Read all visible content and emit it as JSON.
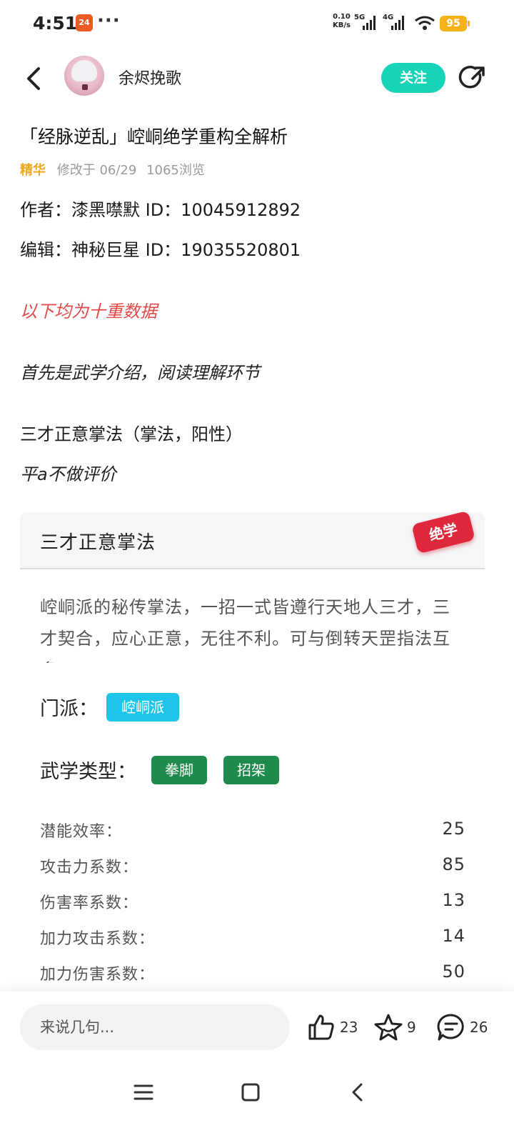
{
  "status_bar": {
    "time": "4:51",
    "app_badge": "24",
    "dots": "···",
    "net_speed_value": "0.10",
    "net_speed_unit": "KB/s",
    "sig1_label": "5G",
    "sig2_label": "4G",
    "battery": "95",
    "icons": [
      "signal-icon",
      "wifi-icon",
      "battery-icon"
    ]
  },
  "header": {
    "username": "余烬挽歌",
    "follow_label": "关注"
  },
  "article": {
    "title": "「经脉逆乱」崆峒绝学重构全解析",
    "tag": "精华",
    "modified": "修改于 06/29",
    "views": "1065浏览",
    "author_line": "作者：漆黑噤默  ID：10045912892",
    "editor_line": "编辑：神秘巨星  ID：19035520801",
    "note_red": "以下均为十重数据",
    "intro": "首先是武学介绍，阅读理解环节",
    "skill_heading": "三才正意掌法（掌法，阳性）",
    "skill_comment": "平a不做评价"
  },
  "skill_card": {
    "name": "三才正意掌法",
    "badge": "绝学",
    "description": "崆峒派的秘传掌法，一招一式皆遵行天地人三才，三才契合，应心正意，无往不利。可与倒转天罡指法互多",
    "sect_label": "门派：",
    "sect_value": "崆峒派",
    "type_label": "武学类型：",
    "types": [
      "拳脚",
      "招架"
    ],
    "stats": [
      {
        "name": "潜能效率：",
        "value": "25"
      },
      {
        "name": "攻击力系数：",
        "value": "85"
      },
      {
        "name": "伤害率系数：",
        "value": "13"
      },
      {
        "name": "加力攻击系数：",
        "value": "14"
      },
      {
        "name": "加力伤害系数：",
        "value": "50"
      }
    ]
  },
  "bottom_bar": {
    "comment_placeholder": "来说几句...",
    "likes": "23",
    "favorites": "9",
    "comments": "26"
  },
  "colors": {
    "accent": "#17d4b8",
    "tag": "#f0a81c",
    "red_note": "#e04a4a",
    "badge": "#e0283c",
    "chip_blue": "#1fc4ea",
    "chip_green": "#1e8a4c"
  }
}
